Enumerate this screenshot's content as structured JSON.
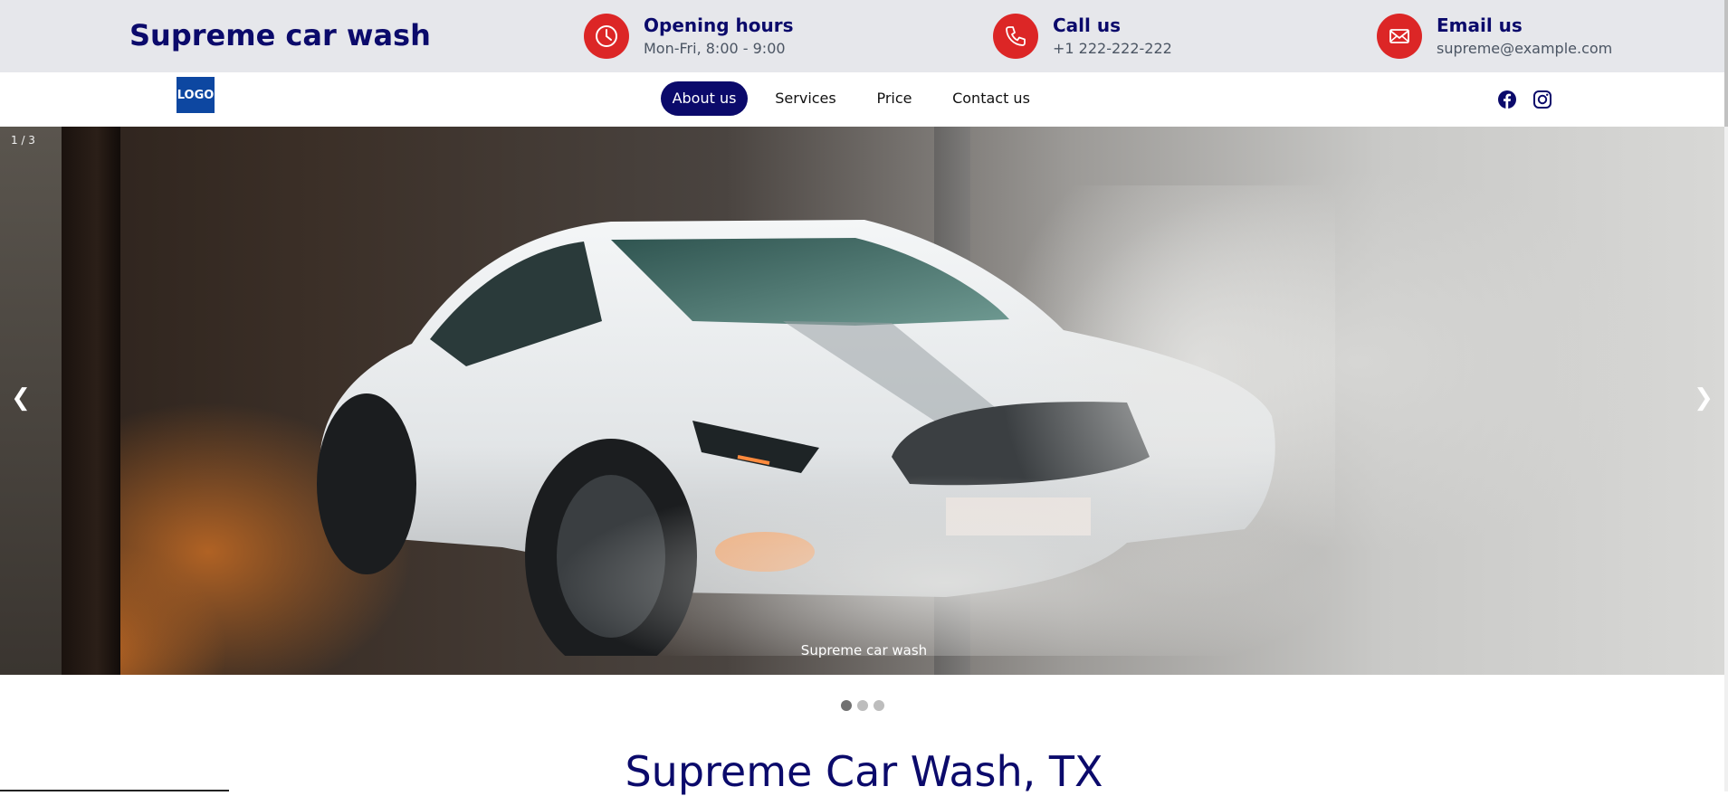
{
  "header": {
    "brand": "Supreme car wash",
    "info": [
      {
        "title": "Opening hours",
        "subtitle": "Mon-Fri, 8:00 - 9:00",
        "icon": "clock-icon"
      },
      {
        "title": "Call us",
        "subtitle": "+1 222-222-222",
        "icon": "phone-icon"
      },
      {
        "title": "Email us",
        "subtitle": "supreme@example.com",
        "icon": "mail-icon"
      }
    ],
    "accent_color": "#dc2626",
    "brand_color": "#0b0a6b"
  },
  "nav": {
    "logo_label": "LOGO",
    "items": [
      {
        "label": "About us",
        "active": true
      },
      {
        "label": "Services",
        "active": false
      },
      {
        "label": "Price",
        "active": false
      },
      {
        "label": "Contact us",
        "active": false
      }
    ],
    "social": [
      "facebook-icon",
      "instagram-icon"
    ]
  },
  "carousel": {
    "counter": "1 / 3",
    "prev_label": "❮",
    "next_label": "❯",
    "caption": "Supreme car wash",
    "current_slide": 1,
    "slide_count": 3
  },
  "main": {
    "heading": "Supreme Car Wash, TX"
  }
}
